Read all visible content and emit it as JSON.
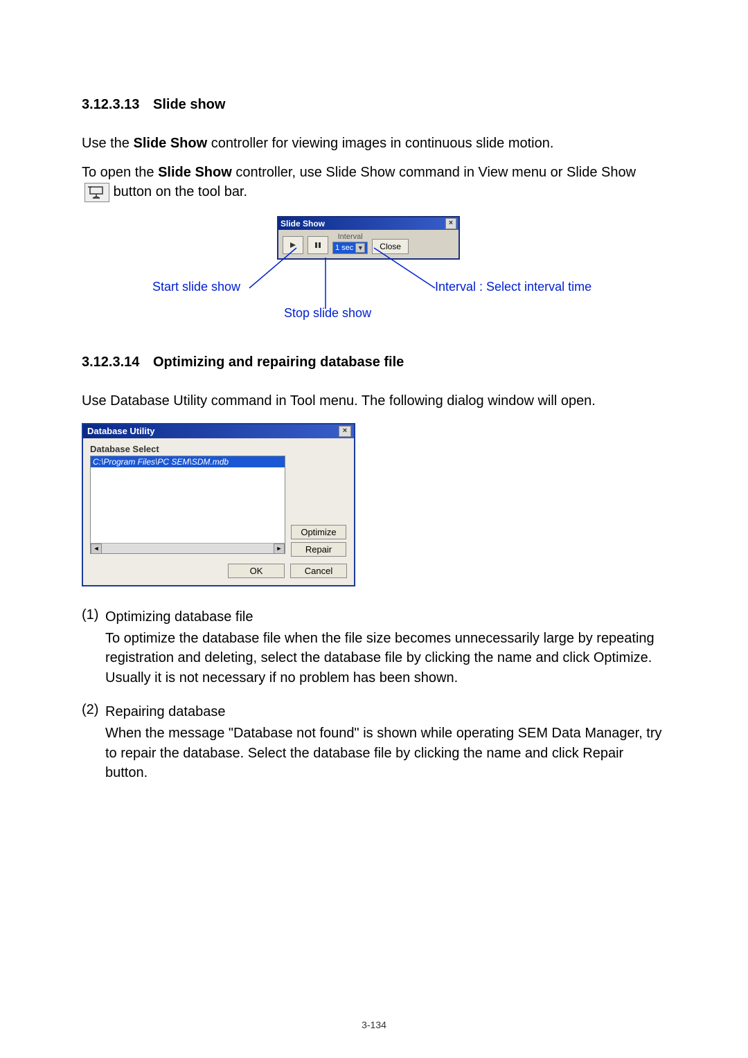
{
  "sections": {
    "slideShow": {
      "num": "3.12.3.13",
      "title": "Slide show",
      "p1_a": "Use the ",
      "p1_bold": "Slide Show",
      "p1_b": " controller for viewing images in continuous slide motion.",
      "p2_a": "To open the ",
      "p2_bold": "Slide Show",
      "p2_b": " controller, use Slide Show command in View menu or Slide Show ",
      "p2_c": " button on the tool bar."
    },
    "dbUtil": {
      "num": "3.12.3.14",
      "title": "Optimizing and repairing database file",
      "p1": "Use Database Utility command in Tool menu. The following dialog window will open."
    }
  },
  "slideShowDialog": {
    "title": "Slide Show",
    "intervalLabel": "Interval",
    "intervalValue": "1 sec",
    "closeBtn": "Close"
  },
  "callouts": {
    "startSlideShow": "Start slide show",
    "stopSlideShow": "Stop slide show",
    "interval": "Interval : Select interval time"
  },
  "dbDialog": {
    "title": "Database Utility",
    "group": "Database Select",
    "selectedFile": "C:\\Program Files\\PC SEM\\SDM.mdb",
    "optimize": "Optimize",
    "repair": "Repair",
    "ok": "OK",
    "cancel": "Cancel"
  },
  "list": {
    "item1": {
      "marker": "(1)",
      "title": "Optimizing database file",
      "body": "To optimize the database file when the file size becomes unnecessarily large by repeating registration and deleting, select the database file by clicking the name and click Optimize. Usually it is not necessary if no problem has been shown."
    },
    "item2": {
      "marker": "(2)",
      "title": "Repairing database",
      "body": "When the message \"Database not found\" is shown while operating SEM Data Manager, try to repair the database. Select the database file by clicking the name and click Repair button."
    }
  },
  "pageNumber": "3-134"
}
